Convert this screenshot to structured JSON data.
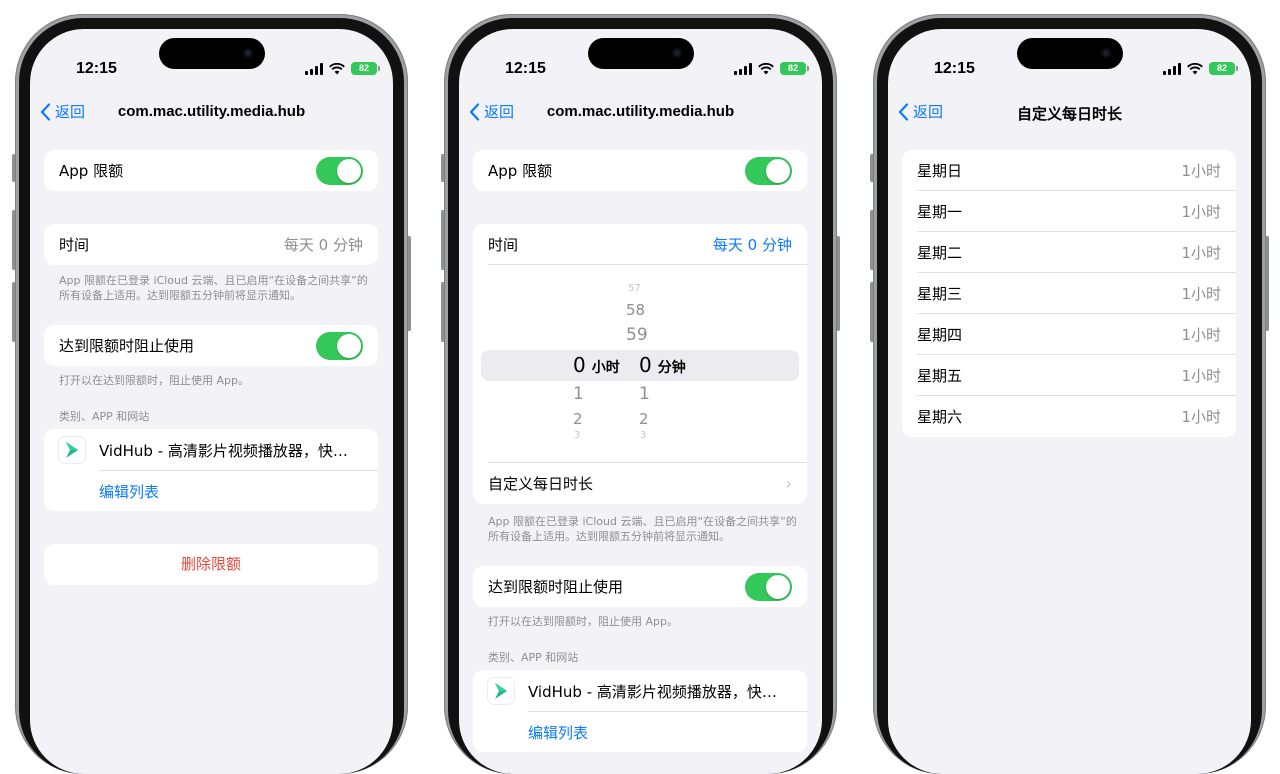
{
  "status": {
    "time": "12:15",
    "battery": "82"
  },
  "phone1": {
    "back": "返回",
    "title": "com.mac.utility.media.hub",
    "limit_label": "App 限额",
    "time_label": "时间",
    "time_value": "每天 0 分钟",
    "note1": "App 限额在已登录 iCloud 云端、且已启用“在设备之间共享”的所有设备上适用。达到限额五分钟前将显示通知。",
    "block_label": "达到限额时阻止使用",
    "note2": "打开以在达到限额时，阻止使用 App。",
    "section": "类别、APP 和网站",
    "app_name": "VidHub - 高清影片视频播放器，快…",
    "edit_list": "编辑列表",
    "delete": "删除限额"
  },
  "phone2": {
    "back": "返回",
    "title": "com.mac.utility.media.hub",
    "limit_label": "App 限额",
    "time_label": "时间",
    "time_value": "每天 0 分钟",
    "picker": {
      "hours_above": [
        "57",
        "58",
        "59"
      ],
      "hours_below": [
        "1",
        "2",
        "3"
      ],
      "hours_selected": "0",
      "hours_unit": "小时",
      "minutes_selected": "0",
      "minutes_unit": "分钟",
      "minutes_below": [
        "1",
        "2",
        "3"
      ]
    },
    "custom": "自定义每日时长",
    "note1": "App 限额在已登录 iCloud 云端、且已启用“在设备之间共享”的所有设备上适用。达到限额五分钟前将显示通知。",
    "block_label": "达到限额时阻止使用",
    "note2": "打开以在达到限额时，阻止使用 App。",
    "section": "类别、APP 和网站",
    "app_name": "VidHub - 高清影片视频播放器，快…",
    "edit_list": "编辑列表"
  },
  "phone3": {
    "back": "返回",
    "title": "自定义每日时长",
    "days": [
      {
        "day": "星期日",
        "value": "1小时"
      },
      {
        "day": "星期一",
        "value": "1小时"
      },
      {
        "day": "星期二",
        "value": "1小时"
      },
      {
        "day": "星期三",
        "value": "1小时"
      },
      {
        "day": "星期四",
        "value": "1小时"
      },
      {
        "day": "星期五",
        "value": "1小时"
      },
      {
        "day": "星期六",
        "value": "1小时"
      }
    ]
  },
  "colors": {
    "accent": "#0a7aff",
    "toggle_on": "#34c759",
    "destructive": "#e5483b",
    "background": "#f2f2f7"
  }
}
